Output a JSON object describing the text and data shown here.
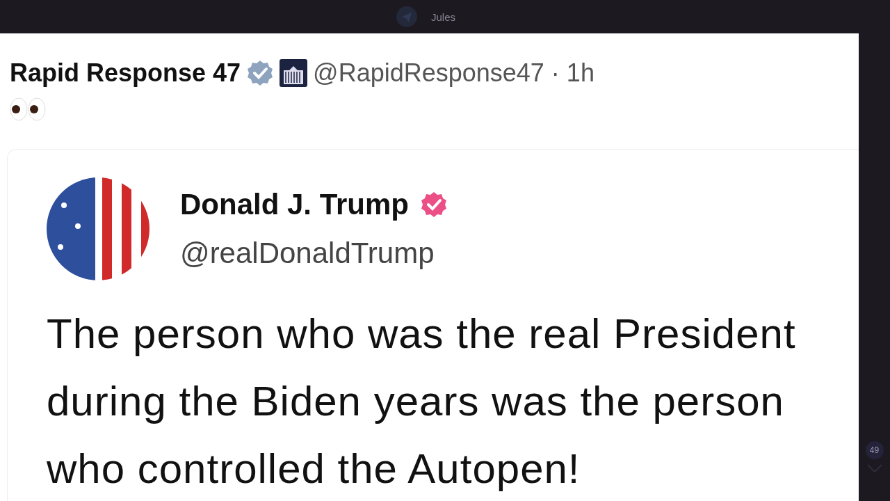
{
  "app_bar": {
    "title": "Jules",
    "unread_count": "49"
  },
  "post": {
    "author": "Rapid Response 47",
    "verified": true,
    "handle": "@RapidResponse47",
    "separator": "·",
    "time": "1h",
    "quoted": {
      "author": "Donald J. Trump",
      "verified": true,
      "handle": "@realDonaldTrump",
      "text": "The person who was the real President during the Biden years was the person who controlled the Autopen!"
    }
  }
}
